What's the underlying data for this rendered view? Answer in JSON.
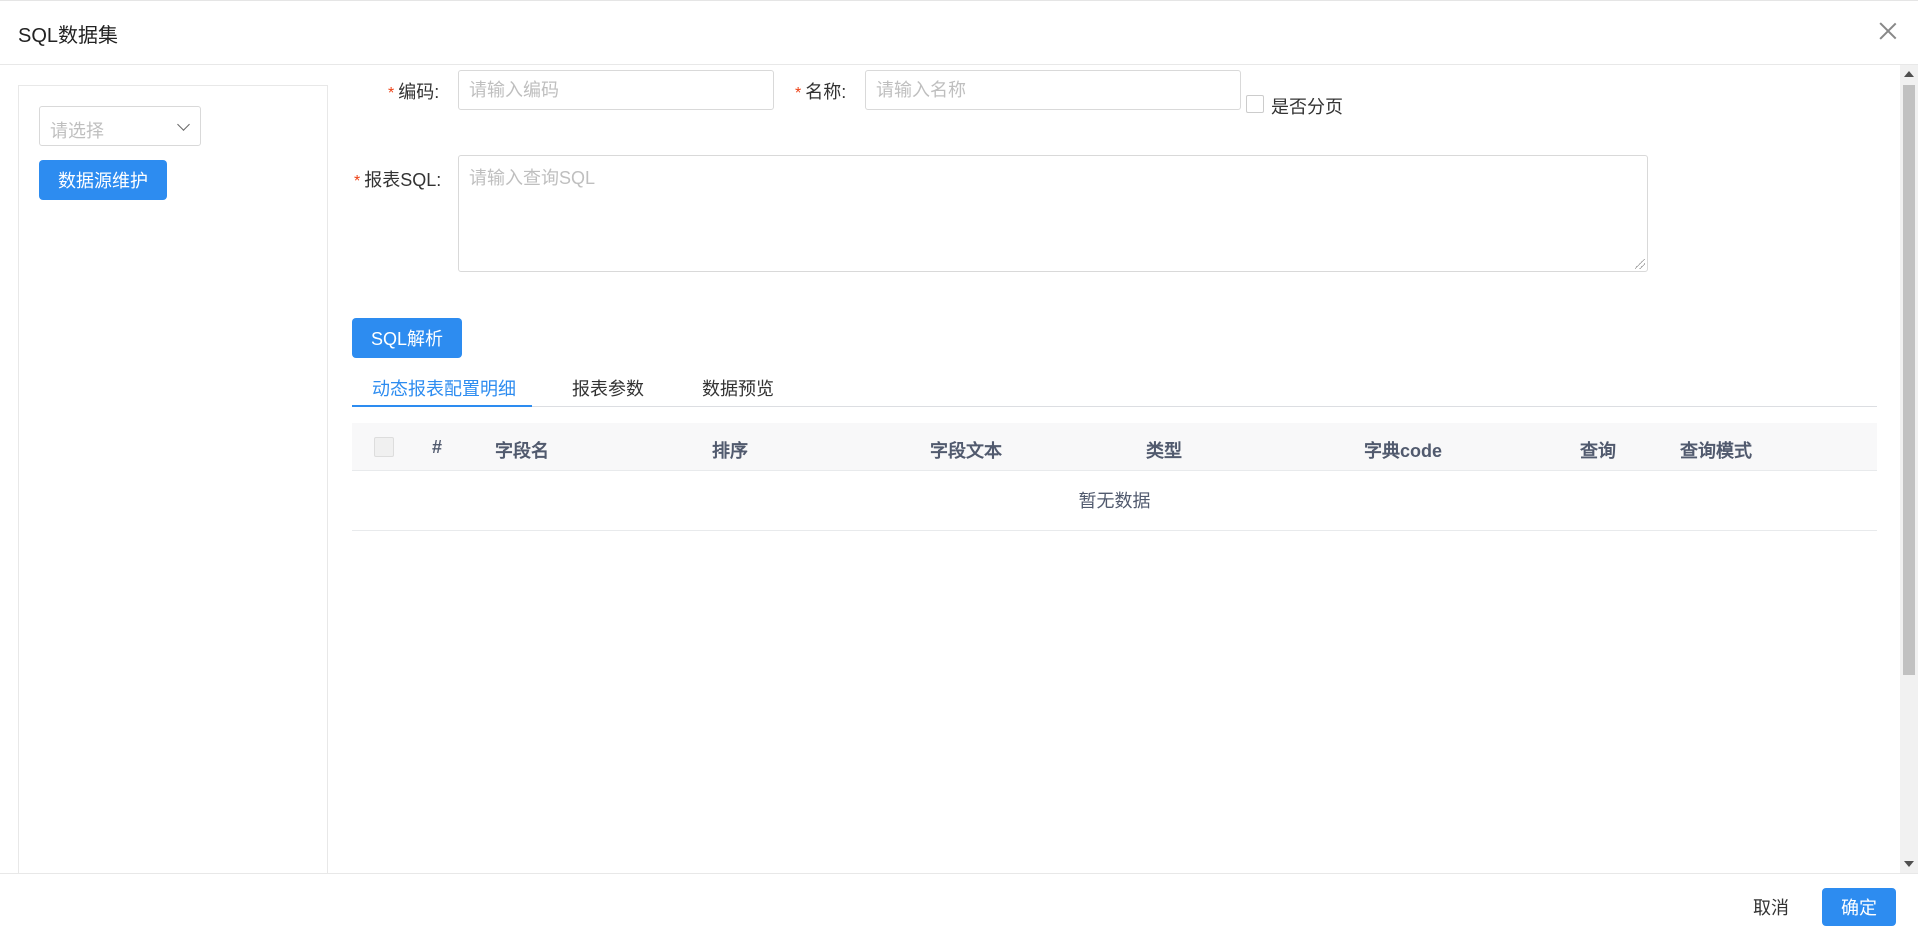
{
  "dialog": {
    "title": "SQL数据集"
  },
  "left_panel": {
    "datasource_select": {
      "placeholder": "请选择"
    },
    "maintain_button": "数据源维护"
  },
  "form": {
    "code": {
      "label": "编码:",
      "placeholder": "请输入编码",
      "required": true
    },
    "name": {
      "label": "名称:",
      "placeholder": "请输入名称",
      "required": true
    },
    "paging": {
      "label": "是否分页",
      "checked": false
    },
    "sql": {
      "label": "报表SQL:",
      "placeholder": "请输入查询SQL",
      "required": true
    },
    "parse_button": "SQL解析"
  },
  "tabs": [
    {
      "label": "动态报表配置明细",
      "active": true
    },
    {
      "label": "报表参数",
      "active": false
    },
    {
      "label": "数据预览",
      "active": false
    }
  ],
  "table": {
    "columns": [
      "#",
      "字段名",
      "排序",
      "字段文本",
      "类型",
      "字典code",
      "查询",
      "查询模式"
    ],
    "empty_text": "暂无数据"
  },
  "footer": {
    "cancel": "取消",
    "ok": "确定"
  },
  "colors": {
    "primary": "#2d8cf0",
    "required": "#ed4014"
  }
}
